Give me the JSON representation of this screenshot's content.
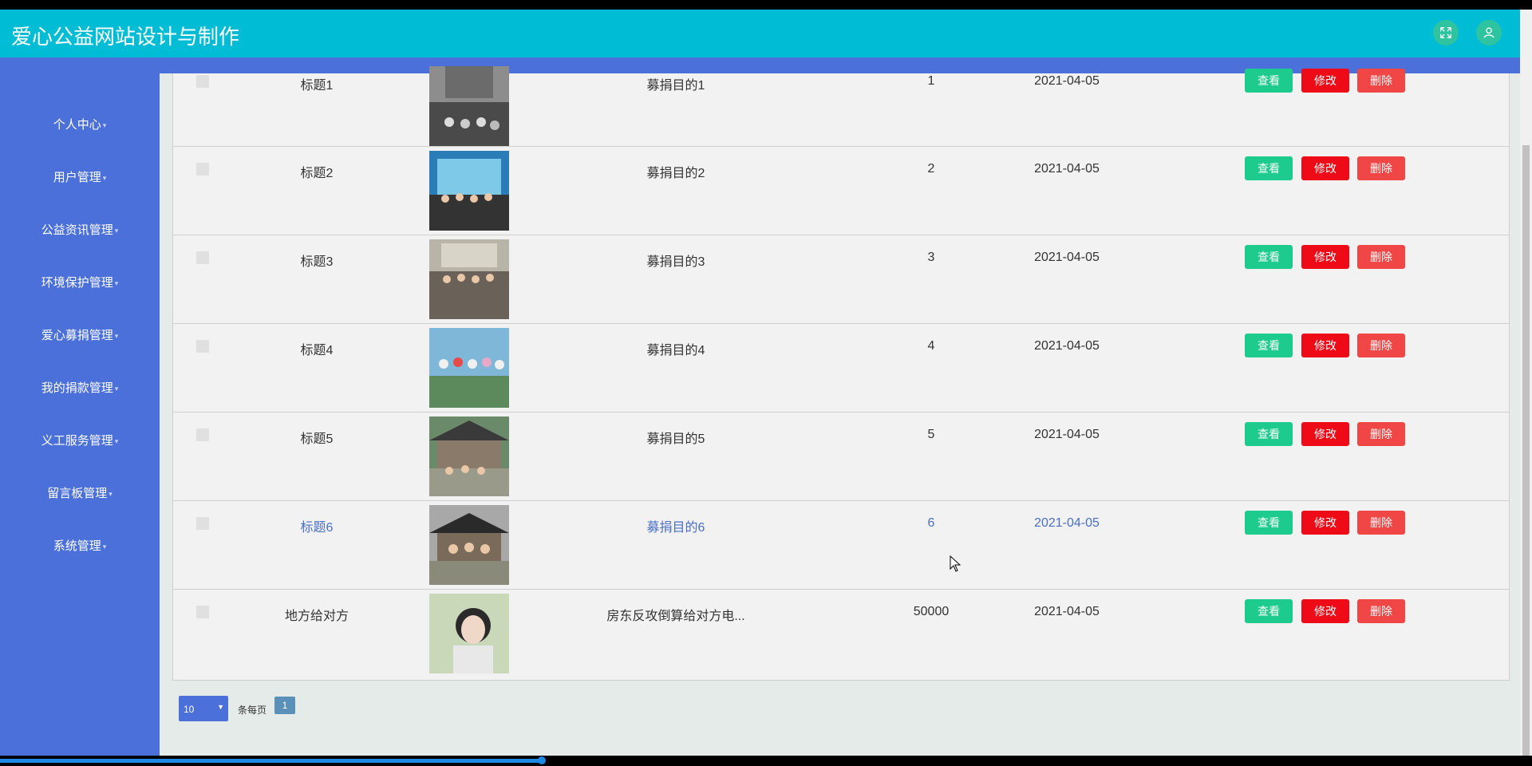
{
  "app": {
    "title": "爱心公益网站设计与制作"
  },
  "header": {
    "fullscreen_icon": "fullscreen-icon",
    "user_icon": "user-icon"
  },
  "sidebar": {
    "items": [
      {
        "label": "个人中心"
      },
      {
        "label": "用户管理"
      },
      {
        "label": "公益资讯管理"
      },
      {
        "label": "环境保护管理"
      },
      {
        "label": "爱心募捐管理"
      },
      {
        "label": "我的捐款管理"
      },
      {
        "label": "义工服务管理"
      },
      {
        "label": "留言板管理"
      },
      {
        "label": "系统管理"
      }
    ]
  },
  "table": {
    "actions": {
      "view": "查看",
      "edit": "修改",
      "delete": "删除"
    },
    "rows": [
      {
        "title": "标题1",
        "purpose": "募捐目的1",
        "amount": "1",
        "date": "2021-04-05"
      },
      {
        "title": "标题2",
        "purpose": "募捐目的2",
        "amount": "2",
        "date": "2021-04-05"
      },
      {
        "title": "标题3",
        "purpose": "募捐目的3",
        "amount": "3",
        "date": "2021-04-05"
      },
      {
        "title": "标题4",
        "purpose": "募捐目的4",
        "amount": "4",
        "date": "2021-04-05"
      },
      {
        "title": "标题5",
        "purpose": "募捐目的5",
        "amount": "5",
        "date": "2021-04-05"
      },
      {
        "title": "标题6",
        "purpose": "募捐目的6",
        "amount": "6",
        "date": "2021-04-05"
      },
      {
        "title": "地方给对方",
        "purpose": "房东反攻倒算给对方电...",
        "amount": "50000",
        "date": "2021-04-05"
      }
    ]
  },
  "pager": {
    "page_size": "10",
    "per_page_label": "条每页",
    "current_page": "1"
  },
  "colors": {
    "header": "#00bcd4",
    "sidebar": "#4c70d9",
    "view": "#1ecb8f",
    "edit": "#ee0a16",
    "delete": "#f04646"
  }
}
